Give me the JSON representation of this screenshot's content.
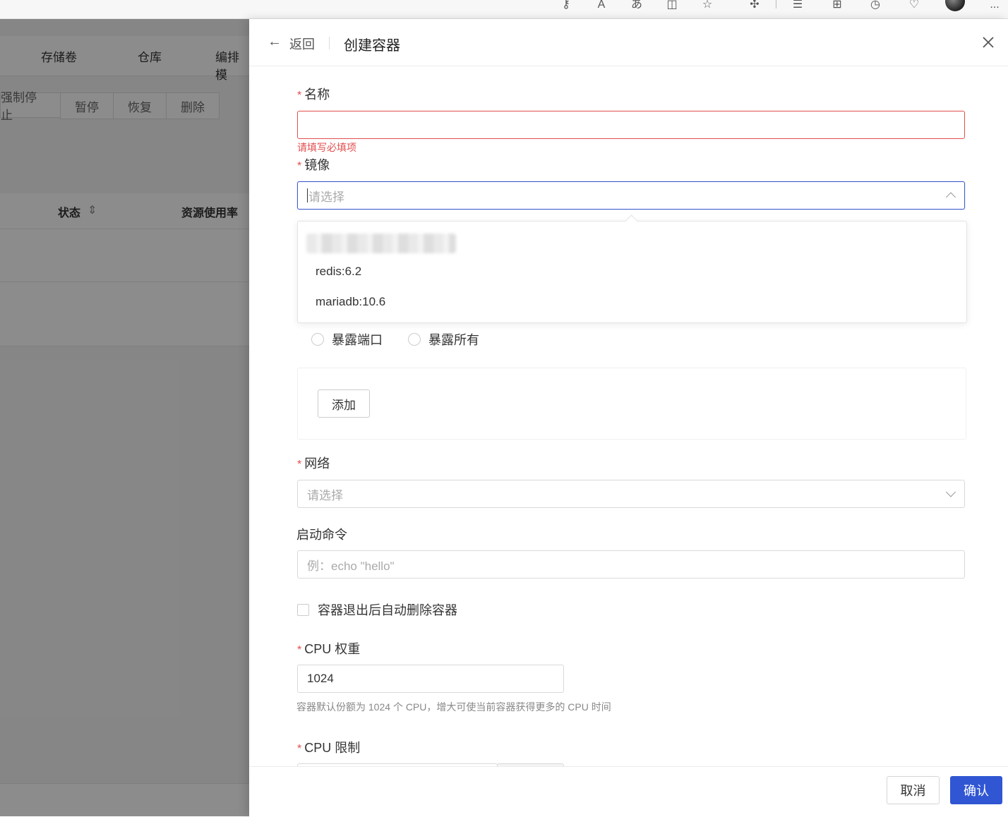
{
  "browser": {
    "icons": [
      "key-icon",
      "read-aloud-icon",
      "translate-icon",
      "split-screen-icon",
      "favorite-star-icon",
      "extensions-icon",
      "favorites-list-icon",
      "collections-icon",
      "history-icon",
      "browser-essentials-icon",
      "profile-avatar",
      "more-menu-icon"
    ],
    "more_label": "..."
  },
  "background": {
    "nav": [
      "存储卷",
      "仓库",
      "编排模"
    ],
    "actions": [
      "强制停止",
      "暂停",
      "恢复",
      "删除"
    ],
    "columns": [
      "状态",
      "资源使用率"
    ],
    "sort_glyph": "⇕"
  },
  "drawer": {
    "back_label": "返回",
    "title": "创建容器",
    "required_mark": "*",
    "name": {
      "label": "名称",
      "value": "",
      "error": "请填写必填项"
    },
    "image": {
      "label": "镜像",
      "placeholder": "请选择",
      "options": [
        "redis:6.2",
        "mariadb:10.6"
      ]
    },
    "ports": {
      "radios": [
        "暴露端口",
        "暴露所有"
      ],
      "add_label": "添加"
    },
    "network": {
      "label": "网络",
      "placeholder": "请选择"
    },
    "command": {
      "label": "启动命令",
      "placeholder": "例：echo \"hello\""
    },
    "auto_remove": {
      "label": "容器退出后自动删除容器",
      "checked": false
    },
    "cpu_weight": {
      "label": "CPU 权重",
      "value": "1024",
      "help": "容器默认份额为 1024 个 CPU，增大可使当前容器获得更多的 CPU 时间"
    },
    "cpu_limit": {
      "label": "CPU 限制"
    },
    "footer": {
      "cancel_label": "取消",
      "confirm_label": "确认"
    },
    "colors": {
      "primary": "#3056d3",
      "error": "#e34d4d"
    }
  }
}
